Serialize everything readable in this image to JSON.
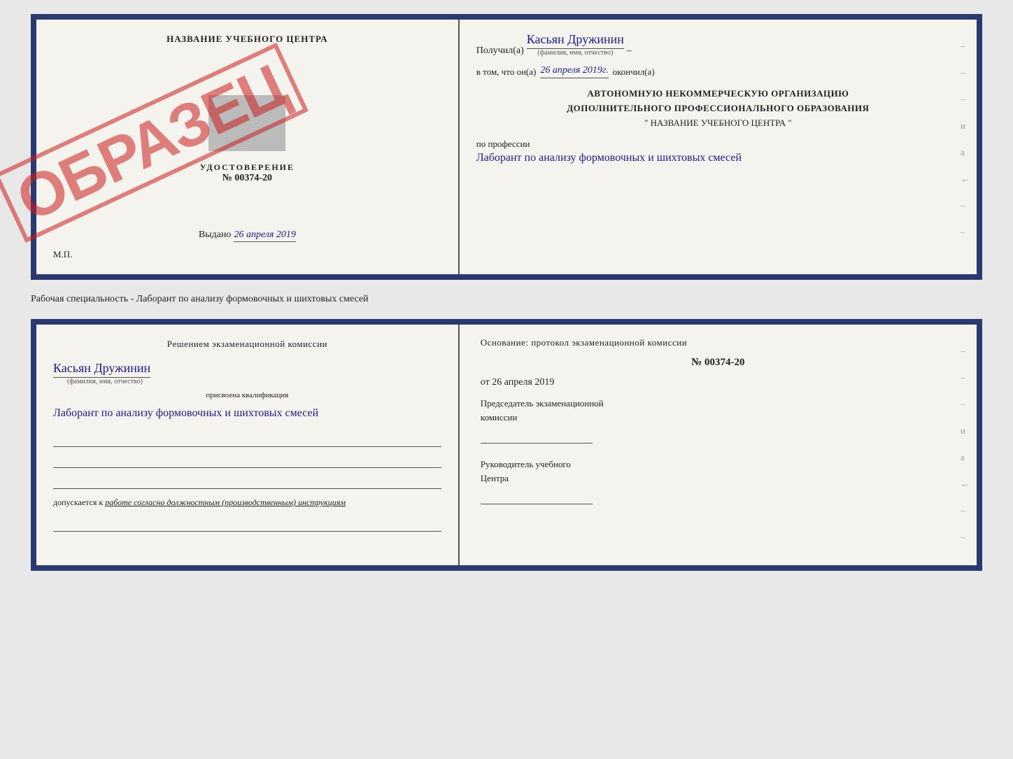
{
  "top_cert": {
    "left": {
      "title": "НАЗВАНИЕ УЧЕБНОГО ЦЕНТРА",
      "stamp": "ОБРАЗЕЦ",
      "udostoverenie": "УДОСТОВЕРЕНИЕ",
      "number": "№ 00374-20",
      "vydano_label": "Выдано",
      "vydano_date": "26 апреля 2019",
      "mp": "М.П."
    },
    "right": {
      "poluchil_prefix": "Получил(а)",
      "poluchil_name": "Касьян Дружинин",
      "fio_hint": "(фамилия, имя, отчество)",
      "vtom_prefix": "в том, что он(а)",
      "vtom_date": "26 апреля 2019г.",
      "okончил": "окончил(а)",
      "org_line1": "АВТОНОМНУЮ НЕКОММЕРЧЕСКУЮ ОРГАНИЗАЦИЮ",
      "org_line2": "ДОПОЛНИТЕЛЬНОГО ПРОФЕССИОНАЛЬНОГО ОБРАЗОВАНИЯ",
      "org_name": "\" НАЗВАНИЕ УЧЕБНОГО ЦЕНТРА \"",
      "professii_label": "по профессии",
      "profession": "Лаборант по анализу формовочных и шихтовых смесей",
      "dashes": [
        "–",
        "–",
        "–",
        "и",
        "а",
        "←",
        "–",
        "–"
      ]
    }
  },
  "separator": {
    "text": "Рабочая специальность - Лаборант по анализу формовочных и шихтовых смесей"
  },
  "bottom_cert": {
    "left": {
      "resheniem": "Решением экзаменационной комиссии",
      "name": "Касьян Дружинин",
      "fio_hint": "(фамилия, имя, отчество)",
      "prisvoena": "присвоена квалификация",
      "qualification": "Лаборант по анализу формовочных и шихтовых смесей",
      "dopuskaetsya_prefix": "допускается к",
      "dopuskaetsya_text": "работе согласно должностным (производственным) инструкциям"
    },
    "right": {
      "osnovanie": "Основание: протокол экзаменационной комиссии",
      "number": "№ 00374-20",
      "ot_prefix": "от",
      "ot_date": "26 апреля 2019",
      "chairman_line1": "Председатель экзаменационной",
      "chairman_line2": "комиссии",
      "rukovoditel_line1": "Руководитель учебного",
      "rukovoditel_line2": "Центра",
      "dashes": [
        "–",
        "–",
        "–",
        "и",
        "а",
        "←",
        "–",
        "–"
      ]
    }
  }
}
